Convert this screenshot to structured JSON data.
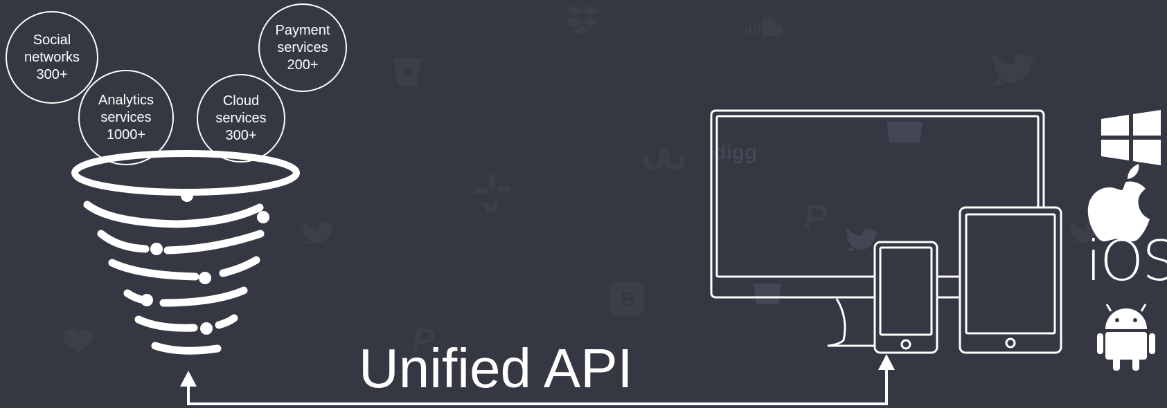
{
  "sources": [
    {
      "id": "social",
      "lines": [
        "Social",
        "networks",
        "300+"
      ]
    },
    {
      "id": "analytics",
      "lines": [
        "Analytics",
        "services",
        "1000+"
      ]
    },
    {
      "id": "cloud",
      "lines": [
        "Cloud",
        "services",
        "300+"
      ]
    },
    {
      "id": "payment",
      "lines": [
        "Payment",
        "services",
        "200+"
      ]
    }
  ],
  "api_label": "Unified API",
  "platforms": {
    "icons": [
      "windows-icon",
      "apple-icon",
      "ios-text-logo",
      "android-icon"
    ],
    "ios_text": "iOS"
  },
  "background_watermarks": [
    "dropbox-icon",
    "soundcloud-icon",
    "twitter-icon",
    "bitbucket-icon",
    "digg-icon",
    "stumbleupon-icon",
    "yelp-icon",
    "paypal-icon",
    "blogger-icon"
  ],
  "colors": {
    "background": "#353742",
    "foreground": "#ffffff",
    "watermark": "#3d3f4b"
  }
}
